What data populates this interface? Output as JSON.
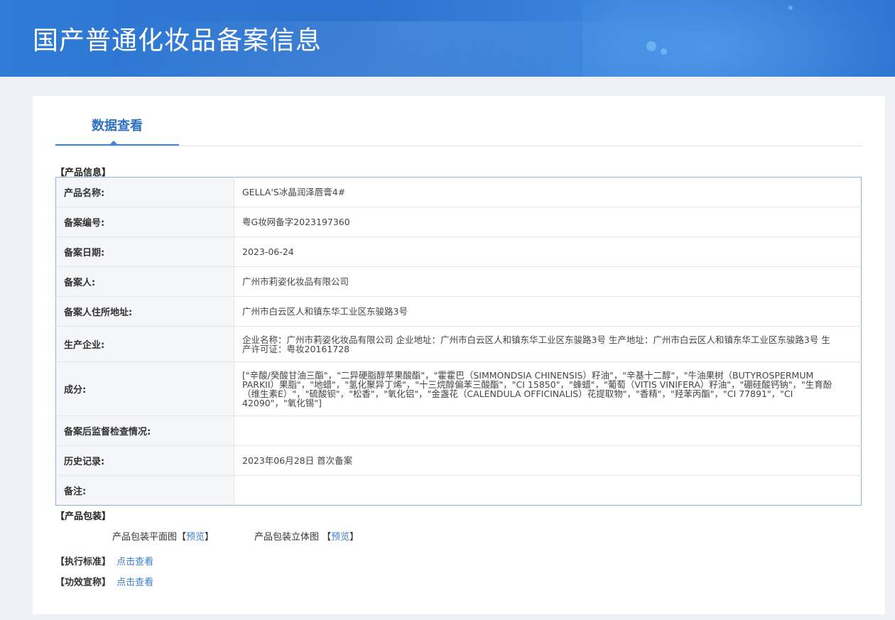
{
  "header": {
    "title": "国产普通化妆品备案信息"
  },
  "tab": {
    "label": "数据查看"
  },
  "product_info": {
    "section_title": "【产品信息】",
    "rows": [
      {
        "key": "产品名称:",
        "value": "GELLA'S冰晶润泽唇膏4#"
      },
      {
        "key": "备案编号:",
        "value": "粤G妆网备字2023197360"
      },
      {
        "key": "备案日期:",
        "value": "2023-06-24"
      },
      {
        "key": "备案人:",
        "value": "广州市莉姿化妆品有限公司"
      },
      {
        "key": "备案人住所地址:",
        "value": "广州市白云区人和镇东华工业区东骏路3号"
      },
      {
        "key": "生产企业:",
        "value": "企业名称：广州市莉姿化妆品有限公司 企业地址：广州市白云区人和镇东华工业区东骏路3号 生产地址：广州市白云区人和镇东华工业区东骏路3号 生产许可证：粤妆20161728"
      },
      {
        "key": "成分:",
        "value": "[\"辛酸/癸酸甘油三酯\"，\"二异硬脂醇苹果酸酯\"，\"霍霍巴（SIMMONDSIA CHINENSIS）籽油\"，\"辛基十二醇\"，\"牛油果树（BUTYROSPERMUM PARKII）果脂\"，\"地蜡\"，\"氢化聚异丁烯\"，\"十三烷醇偏苯三酸酯\"，\"CI 15850\"，\"蜂蜡\"，\"葡萄（VITIS VINIFERA）籽油\"，\"硼硅酸钙钠\"，\"生育酚（维生素E）\"，\"硫酸钡\"，\"松香\"，\"氧化铝\"，\"金盏花（CALENDULA OFFICINALIS）花提取物\"，\"香精\"，\"羟苯丙酯\"，\"CI 77891\"，\"CI 42090\"，\"氧化锡\"]"
      },
      {
        "key": "备案后监督检查情况:",
        "value": ""
      },
      {
        "key": "历史记录:",
        "value": "2023年06月28日 首次备案"
      },
      {
        "key": "备注:",
        "value": ""
      }
    ]
  },
  "packaging": {
    "section_title": "【产品包装】",
    "flat_label": "产品包装平面图【",
    "flat_link": "预览",
    "flat_close": "】",
    "solid_label": "产品包装立体图 【",
    "solid_link": "预览",
    "solid_close": "】"
  },
  "standard": {
    "label": "【执行标准】",
    "link": "点击查看"
  },
  "efficacy": {
    "label": "【功效宣称】",
    "link": "点击查看"
  }
}
